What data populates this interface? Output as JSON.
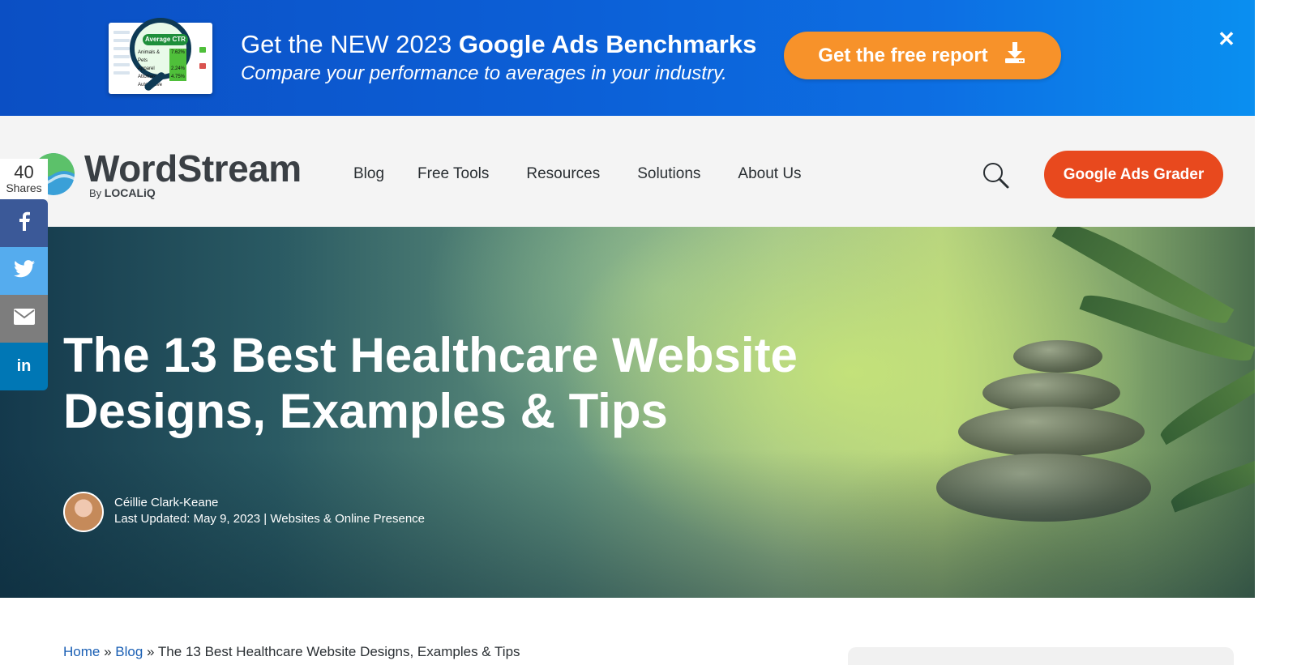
{
  "promo": {
    "headline_pre": "Get the NEW 2023 ",
    "headline_bold": "Google Ads Benchmarks",
    "subline": "Compare your performance to averages in your industry.",
    "cta_label": "Get the free report",
    "thumb": {
      "badge": "Average CTR",
      "rows": [
        {
          "label": "Animals & Pets",
          "value": "7.62%"
        },
        {
          "label": "Apparel",
          "value": "2.24%"
        },
        {
          "label": "Attorneys",
          "value": "4.75%"
        },
        {
          "label": "Automotive",
          "value": ""
        }
      ]
    },
    "colors": {
      "cta": "#f7922a",
      "banner": "#0c5fd6"
    }
  },
  "header": {
    "logo_word": "WordStream",
    "logo_by": "By",
    "logo_brand": "LOCALiQ",
    "nav": [
      "Blog",
      "Free Tools",
      "Resources",
      "Solutions",
      "About Us"
    ],
    "cta_label": "Google Ads Grader",
    "colors": {
      "cta": "#e8491e"
    }
  },
  "share": {
    "count": "40",
    "label": "Shares",
    "buttons": [
      {
        "network": "facebook",
        "icon": "facebook-icon"
      },
      {
        "network": "twitter",
        "icon": "twitter-icon"
      },
      {
        "network": "email",
        "icon": "email-icon"
      },
      {
        "network": "linkedin",
        "icon": "linkedin-icon",
        "glyph": "in"
      }
    ]
  },
  "hero": {
    "title_line1": "The 13 Best Healthcare Website",
    "title_line2": "Designs, Examples & Tips",
    "author": "Céillie Clark-Keane",
    "meta_label": "Last Updated: ",
    "meta_date": "May 9, 2023",
    "meta_sep": " | ",
    "meta_category": "Websites & Online Presence"
  },
  "breadcrumb": {
    "home": "Home",
    "blog": "Blog",
    "current": "The 13 Best Healthcare Website Designs, Examples & Tips"
  }
}
